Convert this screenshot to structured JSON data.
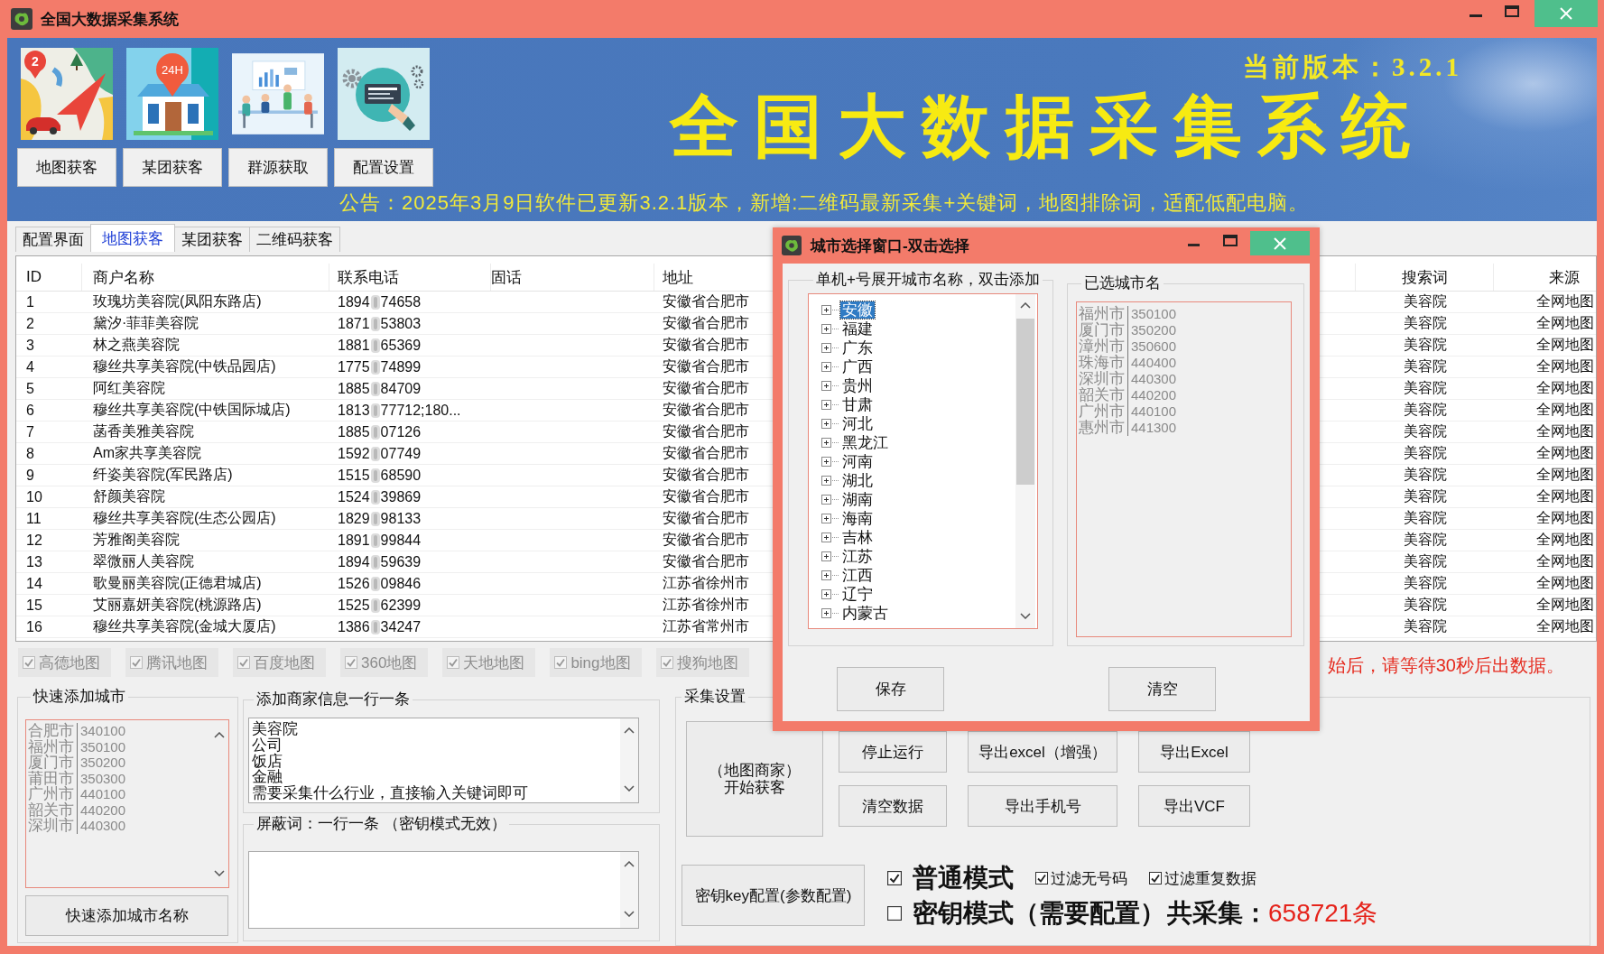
{
  "window": {
    "title": "全国大数据采集系统"
  },
  "banner": {
    "modules": [
      {
        "label": "地图获客",
        "kind": "map",
        "badge": "2"
      },
      {
        "label": "某团获客",
        "kind": "shop",
        "badge": "24H"
      },
      {
        "label": "群源获取",
        "kind": "meeting"
      },
      {
        "label": "配置设置",
        "kind": "settings"
      }
    ],
    "version": "当前版本：3.2.1",
    "headline": "全国大数据采集系统",
    "notice": "公告：2025年3月9日软件已更新3.2.1版本，新增:二维码最新采集+关键词，地图排除词，适配低配电脑。"
  },
  "tabs": [
    {
      "label": "配置界面",
      "selected": false
    },
    {
      "label": "地图获客",
      "selected": true
    },
    {
      "label": "某团获客",
      "selected": false
    },
    {
      "label": "二维码获客",
      "selected": false
    }
  ],
  "table": {
    "columns": [
      "ID",
      "商户名称",
      "联系电话",
      "固话",
      "地址",
      "搜索词",
      "来源"
    ],
    "rows": [
      {
        "id": "1",
        "name": "玫瑰坊美容院(凤阳东路店)",
        "phone": {
          "start": "1894",
          "end": "74658"
        },
        "address": "安徽省合肥市",
        "keyword": "美容院",
        "source": "全网地图"
      },
      {
        "id": "2",
        "name": "黛汐·菲菲美容院",
        "phone": {
          "start": "1871",
          "end": "53803"
        },
        "address": "安徽省合肥市",
        "keyword": "美容院",
        "source": "全网地图"
      },
      {
        "id": "3",
        "name": "林之燕美容院",
        "phone": {
          "start": "1881",
          "end": "65369"
        },
        "address": "安徽省合肥市",
        "keyword": "美容院",
        "source": "全网地图"
      },
      {
        "id": "4",
        "name": "穆丝共享美容院(中铁品园店)",
        "phone": {
          "start": "1775",
          "end": "74899"
        },
        "address": "安徽省合肥市",
        "keyword": "美容院",
        "source": "全网地图"
      },
      {
        "id": "5",
        "name": "阿红美容院",
        "phone": {
          "start": "1885",
          "end": "84709"
        },
        "address": "安徽省合肥市",
        "keyword": "美容院",
        "source": "全网地图"
      },
      {
        "id": "6",
        "name": "穆丝共享美容院(中铁国际城店)",
        "phone": {
          "start": "1813",
          "end": "77712;180..."
        },
        "address": "安徽省合肥市",
        "keyword": "美容院",
        "source": "全网地图"
      },
      {
        "id": "7",
        "name": "菡香美雅美容院",
        "phone": {
          "start": "1885",
          "end": "07126"
        },
        "address": "安徽省合肥市",
        "keyword": "美容院",
        "source": "全网地图"
      },
      {
        "id": "8",
        "name": "Am家共享美容院",
        "phone": {
          "start": "1592",
          "end": "07749"
        },
        "address": "安徽省合肥市",
        "keyword": "美容院",
        "source": "全网地图"
      },
      {
        "id": "9",
        "name": "纤姿美容院(军民路店)",
        "phone": {
          "start": "1515",
          "end": "68590"
        },
        "address": "安徽省合肥市",
        "keyword": "美容院",
        "source": "全网地图"
      },
      {
        "id": "10",
        "name": "舒颜美容院",
        "phone": {
          "start": "1524",
          "end": "39869"
        },
        "address": "安徽省合肥市",
        "keyword": "美容院",
        "source": "全网地图"
      },
      {
        "id": "11",
        "name": "穆丝共享美容院(生态公园店)",
        "phone": {
          "start": "1829",
          "end": "98133"
        },
        "address": "安徽省合肥市",
        "keyword": "美容院",
        "source": "全网地图"
      },
      {
        "id": "12",
        "name": "芳雅阁美容院",
        "phone": {
          "start": "1891",
          "end": "99844"
        },
        "address": "安徽省合肥市",
        "keyword": "美容院",
        "source": "全网地图"
      },
      {
        "id": "13",
        "name": "翠微丽人美容院",
        "phone": {
          "start": "1894",
          "end": "59639"
        },
        "address": "安徽省合肥市",
        "keyword": "美容院",
        "source": "全网地图"
      },
      {
        "id": "14",
        "name": "歌曼丽美容院(正德君城店)",
        "phone": {
          "start": "1526",
          "end": "09846"
        },
        "address": "江苏省徐州市",
        "keyword": "美容院",
        "source": "全网地图"
      },
      {
        "id": "15",
        "name": "艾丽嘉妍美容院(桃源路店)",
        "phone": {
          "start": "1525",
          "end": "62399"
        },
        "address": "江苏省徐州市",
        "keyword": "美容院",
        "source": "全网地图"
      },
      {
        "id": "16",
        "name": "穆丝共享美容院(金城大厦店)",
        "phone": {
          "start": "1386",
          "end": "34247"
        },
        "address": "江苏省常州市",
        "keyword": "美容院",
        "source": "全网地图"
      }
    ]
  },
  "map_sources": [
    {
      "label": "高德地图",
      "checked": true,
      "disabled": true
    },
    {
      "label": "腾讯地图",
      "checked": true,
      "disabled": true
    },
    {
      "label": "百度地图",
      "checked": true,
      "disabled": true
    },
    {
      "label": "360地图",
      "checked": true,
      "disabled": true
    },
    {
      "label": "天地地图",
      "checked": true,
      "disabled": true
    },
    {
      "label": "bing地图",
      "checked": true,
      "disabled": true
    },
    {
      "label": "搜狗地图",
      "checked": true,
      "disabled": true
    }
  ],
  "wait_hint": "始后，请等待30秒后出数据。",
  "quick_city": {
    "title": "快速添加城市",
    "cities": [
      {
        "name": "合肥市",
        "code": "340100"
      },
      {
        "name": "福州市",
        "code": "350100"
      },
      {
        "name": "厦门市",
        "code": "350200"
      },
      {
        "name": "莆田市",
        "code": "350300"
      },
      {
        "name": "广州市",
        "code": "440100"
      },
      {
        "name": "韶关市",
        "code": "440200"
      },
      {
        "name": "深圳市",
        "code": "440300"
      }
    ],
    "button": "快速添加城市名称"
  },
  "merchant_keywords": {
    "title": "添加商家信息一行一条",
    "lines": [
      "美容院",
      "公司",
      "饭店",
      "金融",
      "需要采集什么行业，直接输入关键词即可"
    ]
  },
  "blocked_words": {
    "title": "屏蔽词：一行一条 （密钥模式无效）"
  },
  "collect_settings": {
    "title": "采集设置",
    "start_button": {
      "lines": [
        "（地图商家）",
        "开始获客"
      ]
    },
    "buttons": [
      "停止运行",
      "导出excel（增强）",
      "导出Excel",
      "清空数据",
      "导出手机号",
      "导出VCF"
    ],
    "key_button": "密钥key配置(参数配置)",
    "option_rows": [
      [
        {
          "label": "普通模式",
          "checked": true,
          "kind": "mode"
        },
        {
          "label": "过滤无号码",
          "checked": true,
          "kind": "filter"
        },
        {
          "label": "过滤重复数据",
          "checked": true,
          "kind": "filter"
        }
      ],
      [
        {
          "label": "密钥模式（需要配置）",
          "checked": false,
          "kind": "mode"
        }
      ]
    ],
    "total_label": "共采集：",
    "total_value": "658721条"
  },
  "city_dialog": {
    "title": "城市选择窗口-双击选择",
    "tree_title": "单机+号展开城市名称，双击添加",
    "provinces": [
      {
        "name": "安徽",
        "selected": true,
        "expanded": false
      },
      {
        "name": "福建",
        "selected": false,
        "expanded": false
      },
      {
        "name": "广东",
        "selected": false,
        "expanded": false
      },
      {
        "name": "广西",
        "selected": false,
        "expanded": false
      },
      {
        "name": "贵州",
        "selected": false,
        "expanded": false
      },
      {
        "name": "甘肃",
        "selected": false,
        "expanded": false
      },
      {
        "name": "河北",
        "selected": false,
        "expanded": false
      },
      {
        "name": "黑龙江",
        "selected": false,
        "expanded": false
      },
      {
        "name": "河南",
        "selected": false,
        "expanded": false
      },
      {
        "name": "湖北",
        "selected": false,
        "expanded": false
      },
      {
        "name": "湖南",
        "selected": false,
        "expanded": false
      },
      {
        "name": "海南",
        "selected": false,
        "expanded": false
      },
      {
        "name": "吉林",
        "selected": false,
        "expanded": false
      },
      {
        "name": "江苏",
        "selected": false,
        "expanded": false
      },
      {
        "name": "江西",
        "selected": false,
        "expanded": false
      },
      {
        "name": "辽宁",
        "selected": false,
        "expanded": false
      },
      {
        "name": "内蒙古",
        "selected": false,
        "expanded": false
      }
    ],
    "selected_title": "已选城市名",
    "selected_cities": [
      {
        "name": "福州市",
        "code": "350100"
      },
      {
        "name": "厦门市",
        "code": "350200"
      },
      {
        "name": "漳州市",
        "code": "350600"
      },
      {
        "name": "珠海市",
        "code": "440400"
      },
      {
        "name": "深圳市",
        "code": "440300"
      },
      {
        "name": "韶关市",
        "code": "440200"
      },
      {
        "name": "广州市",
        "code": "440100"
      },
      {
        "name": "惠州市",
        "code": "441300"
      }
    ],
    "buttons": [
      "保存",
      "清空"
    ]
  }
}
